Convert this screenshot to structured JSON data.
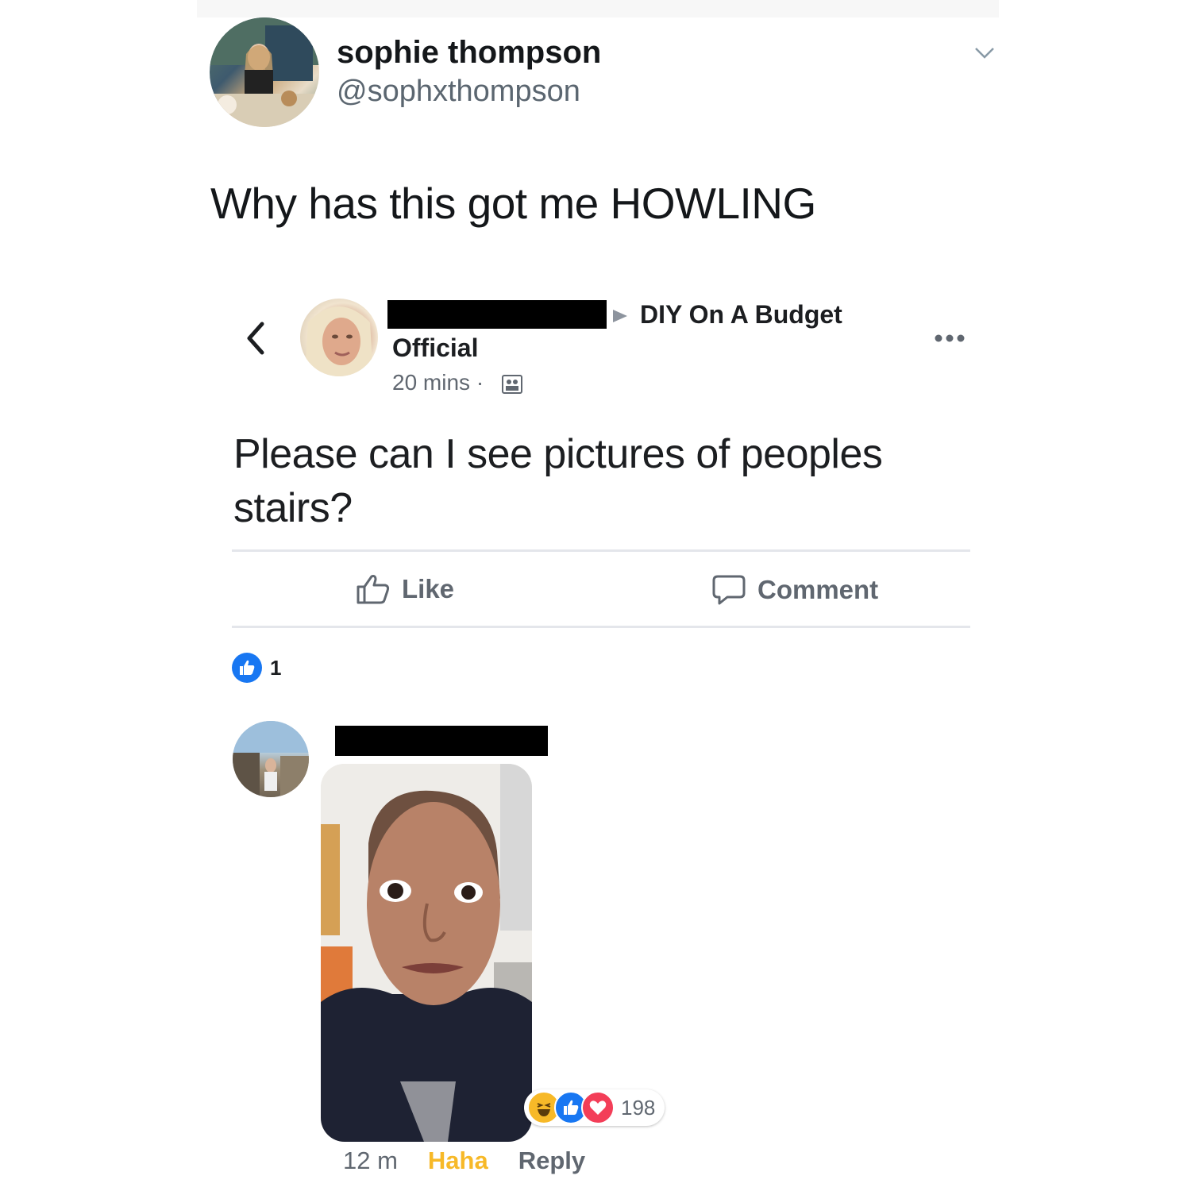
{
  "tweet": {
    "display_name": "sophie thompson",
    "handle": "@sophxthompson",
    "text": "Why has this got me HOWLING"
  },
  "fb_post": {
    "group_name": "DIY On A Budget",
    "author_suffix": "Official",
    "time": "20 mins ·",
    "text": "Please can I see pictures of peoples stairs?",
    "like_label": "Like",
    "comment_label": "Comment",
    "like_count": "1"
  },
  "comment": {
    "reaction_count": "198",
    "time": "12 m",
    "reaction_label": "Haha",
    "reply_label": "Reply"
  },
  "colors": {
    "fb_blue": "#1877f2",
    "haha_yellow": "#f7b928",
    "love_red": "#f33e58",
    "muted_gray": "#606770"
  },
  "icons": {
    "tweet_menu": "chevron-down-icon",
    "back": "chevron-left-icon",
    "arrow": "triangle-right-icon",
    "group": "group-icon",
    "more": "more-dots-icon",
    "like": "thumbs-up-icon",
    "comment": "comment-bubble-icon"
  }
}
